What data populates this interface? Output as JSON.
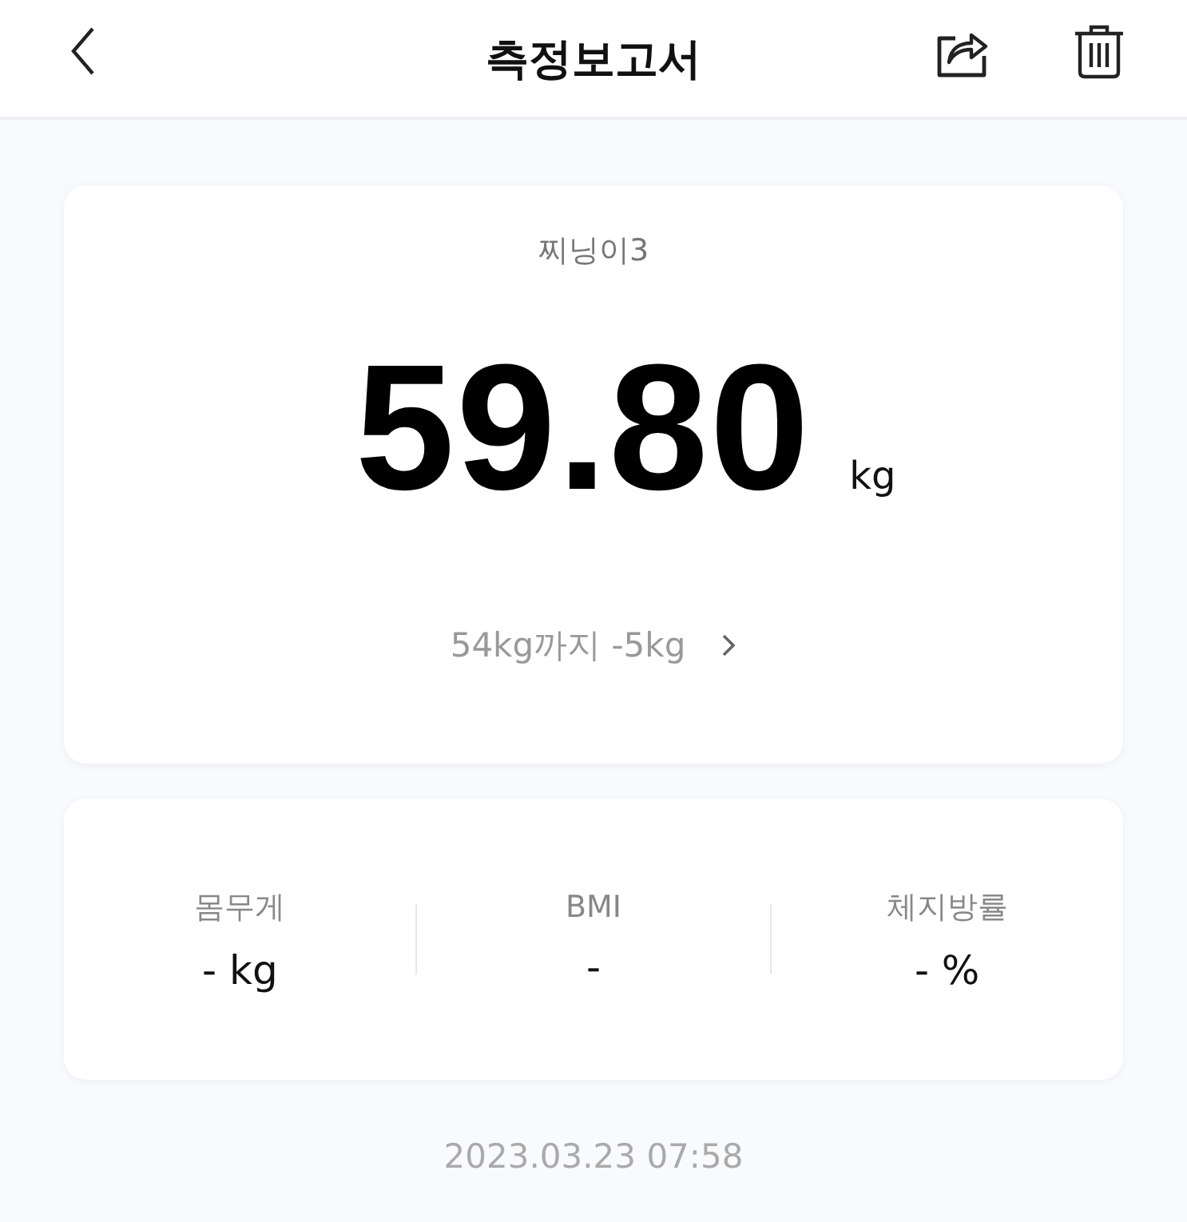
{
  "header": {
    "title": "측정보고서"
  },
  "weight_card": {
    "profile_name": "찌닝이3",
    "weight": "59.80",
    "unit": "kg",
    "goal": "54kg까지 -5kg"
  },
  "metrics": [
    {
      "label": "몸무게",
      "value": "- kg"
    },
    {
      "label": "BMI",
      "value": "-"
    },
    {
      "label": "체지방률",
      "value": "- %"
    }
  ],
  "timestamp": "2023.03.23 07:58"
}
